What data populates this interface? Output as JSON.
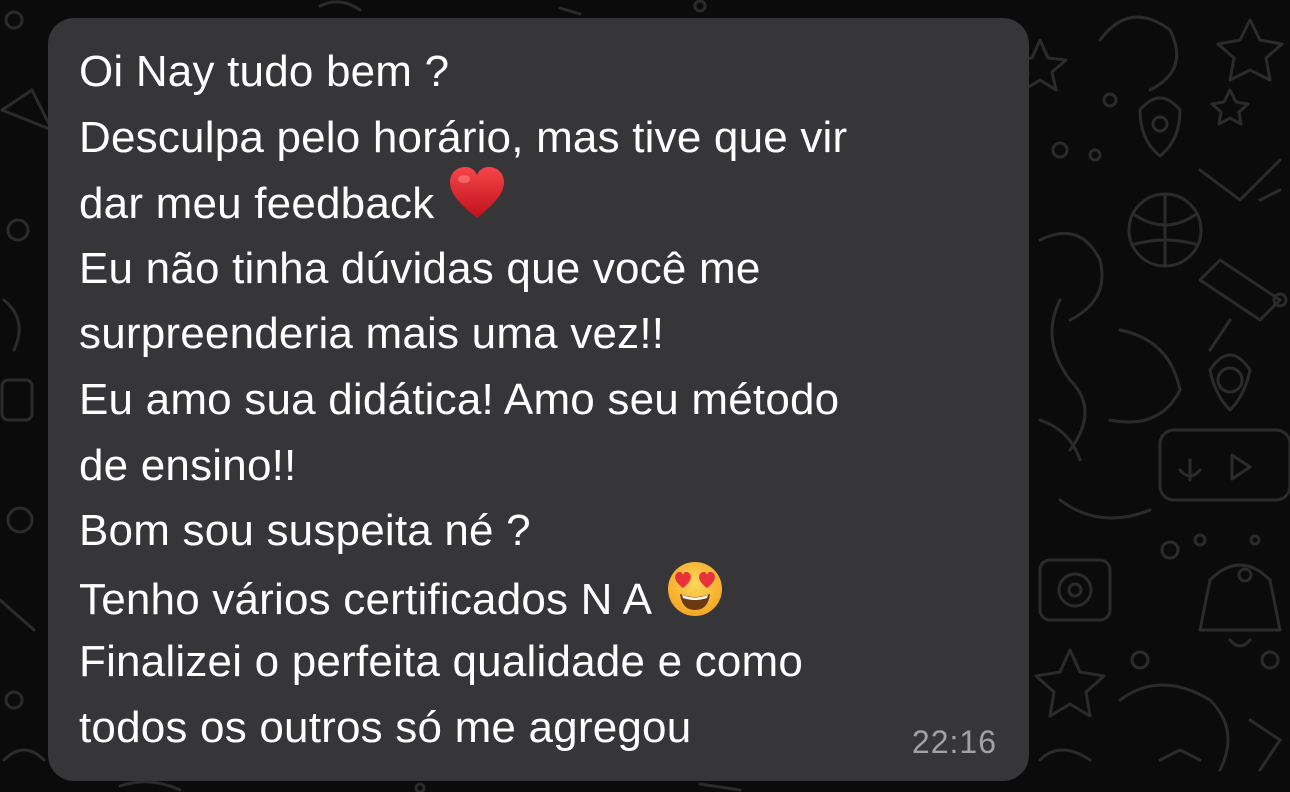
{
  "chat": {
    "background_color": "#0b0b0b",
    "wallpaper_doodle_color": "#2b2b2b",
    "message": {
      "bubble_color": "#363638",
      "text_color": "#ffffff",
      "time_color": "#a1a1a6",
      "lines": [
        "Oi Nay tudo bem ?",
        "Desculpa pelo horário, mas tive que vir",
        "dar meu feedback",
        "Eu não tinha dúvidas que você me",
        "surpreenderia mais uma vez!!",
        "Eu amo sua didática! Amo seu método",
        "de ensino!!",
        "Bom sou suspeita né ?",
        "Tenho vários certificados N A",
        "Finalizei o perfeita qualidade e como",
        "todos os outros só me agregou"
      ],
      "emojis": {
        "line_3": "red-heart-icon",
        "line_9": "heart-eyes-face-icon"
      },
      "time": "22:16"
    }
  }
}
